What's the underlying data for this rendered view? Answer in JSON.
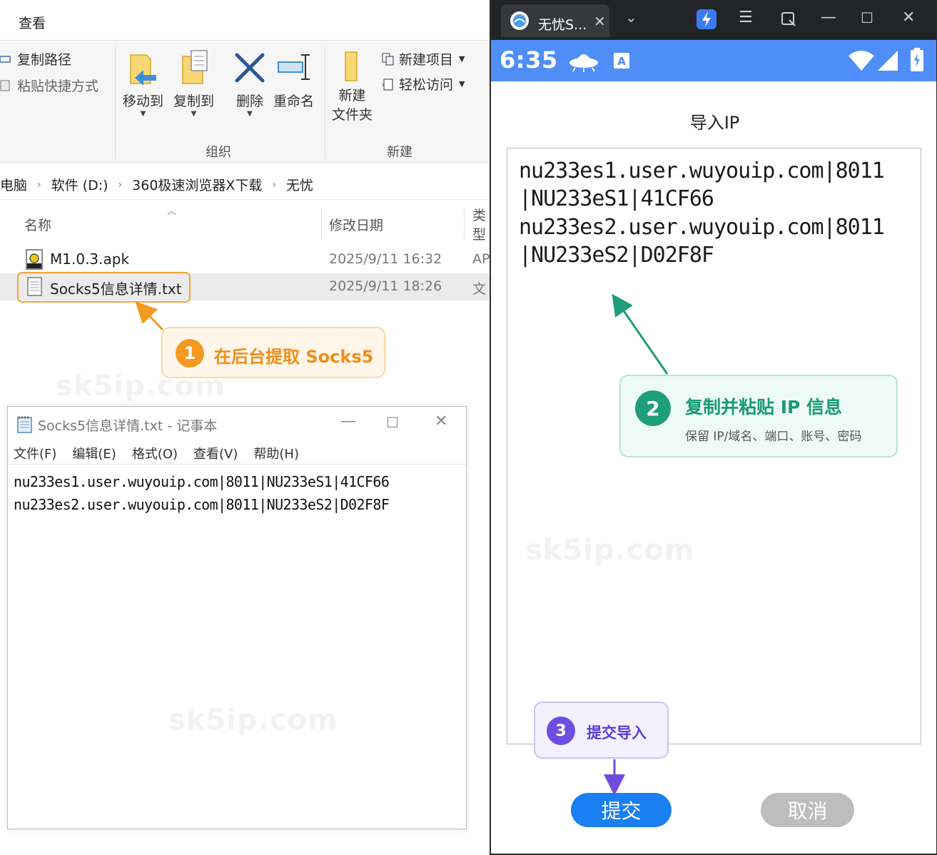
{
  "explorer": {
    "ribbon_tab": "查看",
    "copy_path": "复制路径",
    "paste_shortcut": "粘贴快捷方式",
    "move_to": "移动到",
    "copy_to": "复制到",
    "delete": "删除",
    "rename": "重命名",
    "group_organize": "组织",
    "new_folder_line1": "新建",
    "new_folder_line2": "文件夹",
    "new_item": "新建项目",
    "easy_access": "轻松访问",
    "group_new": "新建",
    "breadcrumbs": [
      "电脑",
      "软件 (D:)",
      "360极速浏览器X下载",
      "无忧"
    ],
    "columns": {
      "name": "名称",
      "date": "修改日期",
      "type": "类型"
    },
    "files": [
      {
        "name": "M1.0.3.apk",
        "date": "2025/9/11 16:32",
        "type": "AP"
      },
      {
        "name": "Socks5信息详情.txt",
        "date": "2025/9/11 18:26",
        "type": "文"
      }
    ]
  },
  "notepad": {
    "title": "Socks5信息详情.txt - 记事本",
    "menu": [
      "文件(F)",
      "编辑(E)",
      "格式(O)",
      "查看(V)",
      "帮助(H)"
    ],
    "lines": [
      "nu233es1.user.wuyouip.com|8011|NU233eS1|41CF66",
      "nu233es2.user.wuyouip.com|8011|NU233eS2|D02F8F"
    ]
  },
  "emulator": {
    "tab_title": "无忧S...",
    "status_time": "6:35",
    "status_bar_color": "#4f8ef7",
    "page_title": "导入IP",
    "textarea_lines": [
      "nu233es1.user.wuyouip.com|8011",
      "|NU233eS1|41CF66",
      "nu233es2.user.wuyouip.com|8011",
      "|NU233eS2|D02F8F"
    ],
    "submit": "提交",
    "cancel": "取消",
    "submit_color": "#1a7ff0",
    "cancel_color": "#bdbdbd"
  },
  "annotations": {
    "step1": {
      "number": "1",
      "text": "在后台提取 Socks5",
      "color": "#f59a20"
    },
    "step2": {
      "number": "2",
      "text": "复制并粘贴 IP 信息",
      "sub": "保留 IP/域名、端口、账号、密码",
      "color": "#1e9e7a"
    },
    "step3": {
      "number": "3",
      "text": "提交导入",
      "color": "#6e4ee0"
    },
    "watermark": "sk5ip.com"
  }
}
